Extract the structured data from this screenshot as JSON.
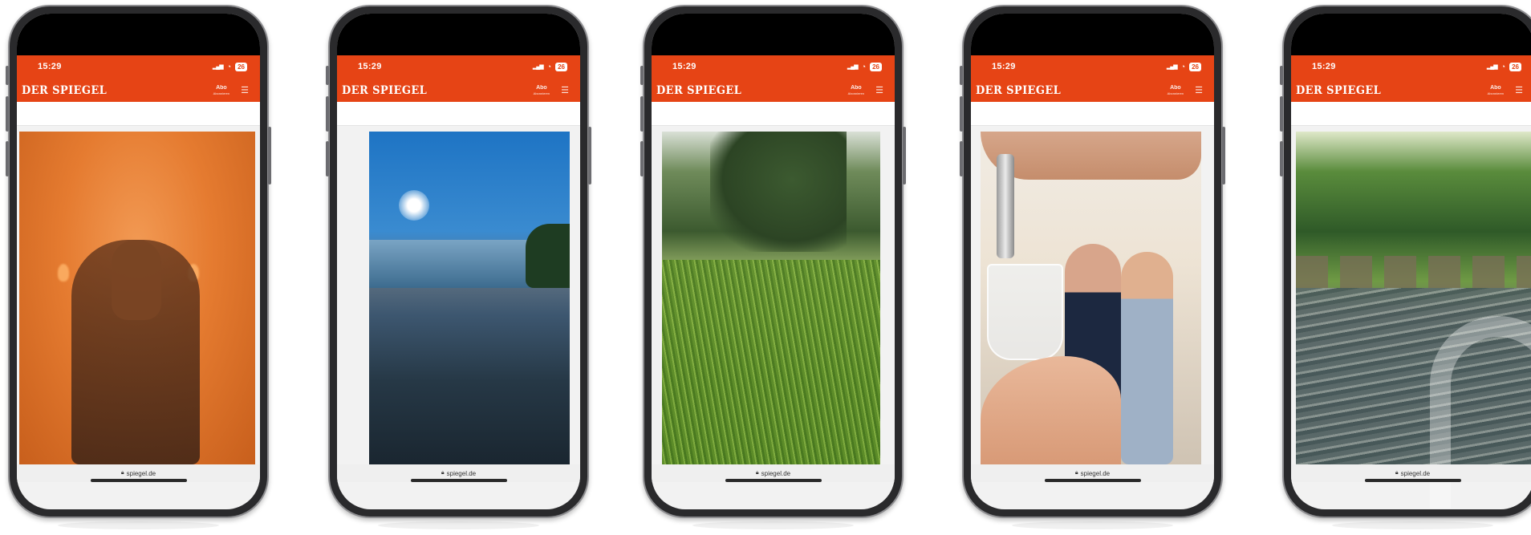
{
  "phones": [
    {
      "status": {
        "time": "15:29",
        "battery": "26"
      },
      "app": {
        "logo": "DER SPIEGEL",
        "abo_label": "Abo",
        "abo_sub": "Abonnieren",
        "menu": "☰"
      },
      "url": "spiegel.de",
      "photo": "woman-in-orange-fog"
    },
    {
      "status": {
        "time": "15:29",
        "battery": "26"
      },
      "app": {
        "logo": "DER SPIEGEL",
        "abo_label": "Abo",
        "abo_sub": "Abonnieren",
        "menu": "☰"
      },
      "url": "spiegel.de",
      "photo": "fountain-square-sun"
    },
    {
      "status": {
        "time": "15:29",
        "battery": "26"
      },
      "app": {
        "logo": "DER SPIEGEL",
        "abo_label": "Abo",
        "abo_sub": "Abonnieren",
        "menu": "☰"
      },
      "url": "spiegel.de",
      "photo": "grass-closeup"
    },
    {
      "status": {
        "time": "15:29",
        "battery": "26"
      },
      "app": {
        "logo": "DER SPIEGEL",
        "abo_label": "Abo",
        "abo_sub": "Abonnieren",
        "menu": "☰"
      },
      "url": "spiegel.de",
      "photo": "water-tap-glass"
    },
    {
      "status": {
        "time": "15:29",
        "battery": "26"
      },
      "app": {
        "logo": "DER SPIEGEL",
        "abo_label": "Abo",
        "abo_sub": "Abonnieren",
        "menu": "☰"
      },
      "url": "spiegel.de",
      "photo": "stream-with-stepping-stones"
    }
  ],
  "colors": {
    "brand": "#e64415",
    "bezel": "#2a2a2c"
  }
}
